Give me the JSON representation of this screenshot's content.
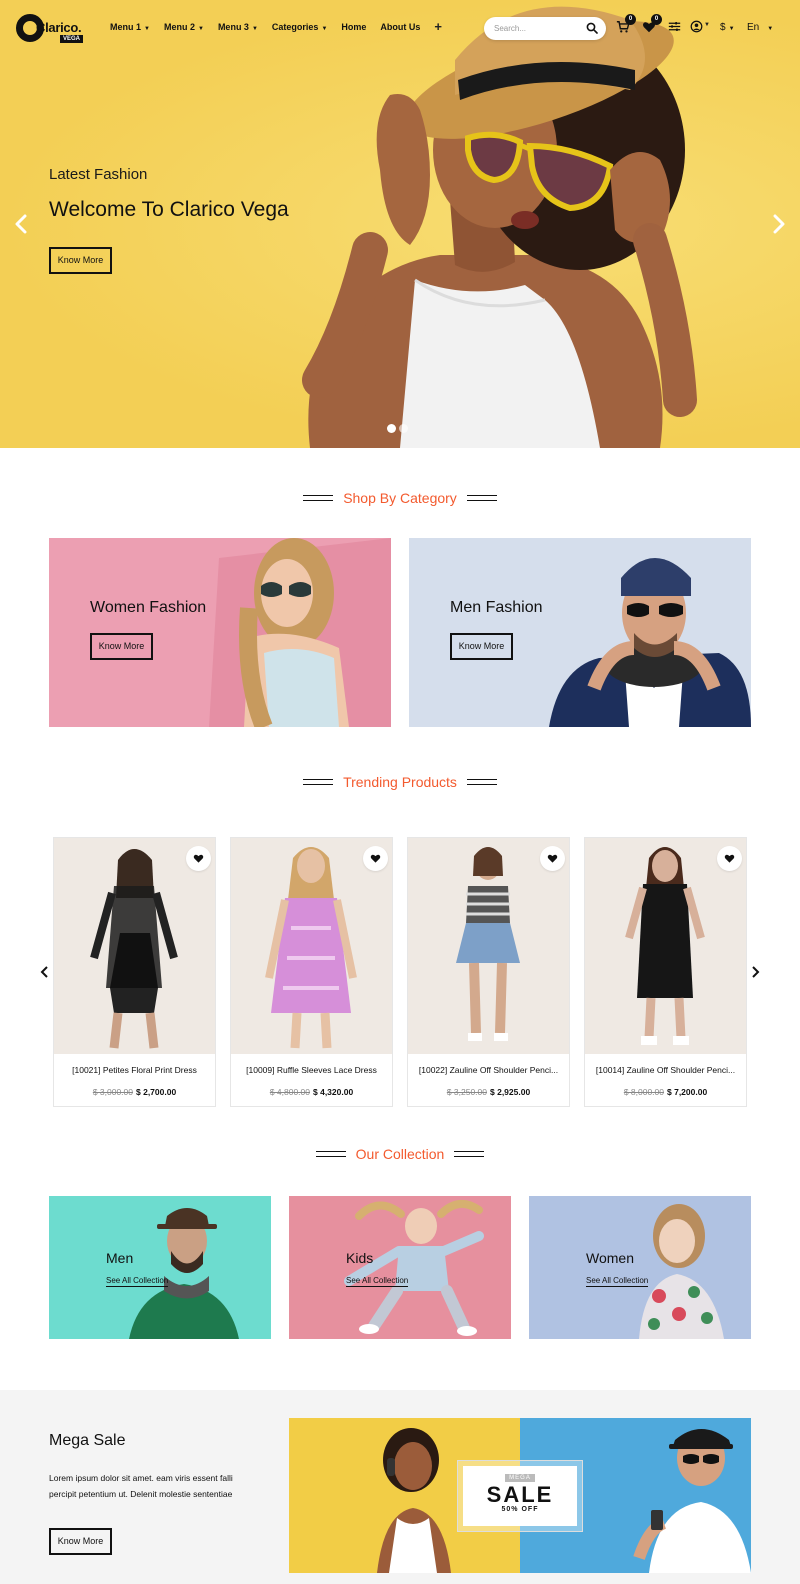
{
  "brand": {
    "name": "Clarico.",
    "tag": "VEGA"
  },
  "nav": {
    "items": [
      "Menu 1",
      "Menu 2",
      "Menu 3",
      "Categories",
      "Home",
      "About Us"
    ],
    "dropdown_flags": [
      true,
      true,
      true,
      true,
      false,
      false
    ],
    "plus": "+"
  },
  "search": {
    "placeholder": "Search..."
  },
  "header_icons": {
    "cart_count": "0",
    "wishlist_count": "0",
    "currency": "$",
    "language": "En"
  },
  "hero": {
    "subtitle": "Latest Fashion",
    "title": "Welcome To Clarico Vega",
    "button": "Know More",
    "slide_count": 2,
    "active_slide": 0,
    "bg_color": "#f6d765"
  },
  "shop_by_category": {
    "title": "Shop By Category",
    "cards": [
      {
        "label": "Women Fashion",
        "button": "Know More",
        "bg": "#ec9fb2"
      },
      {
        "label": "Men Fashion",
        "button": "Know More",
        "bg": "#cfd9ea"
      }
    ]
  },
  "trending": {
    "title": "Trending Products",
    "products": [
      {
        "name": "[10021] Petites Floral Print Dress",
        "old_price": "$ 3,000.00",
        "price": "$ 2,700.00"
      },
      {
        "name": "[10009] Ruffle Sleeves Lace Dress",
        "old_price": "$ 4,800.00",
        "price": "$ 4,320.00"
      },
      {
        "name": "[10022] Zauline Off Shoulder Penci...",
        "old_price": "$ 3,250.00",
        "price": "$ 2,925.00"
      },
      {
        "name": "[10014] Zauline Off Shoulder Penci...",
        "old_price": "$ 8,000.00",
        "price": "$ 7,200.00"
      }
    ]
  },
  "collection": {
    "title": "Our Collection",
    "cards": [
      {
        "label": "Men",
        "link": "See All Collection",
        "bg": "#6ddccf"
      },
      {
        "label": "Kids",
        "link": "See All Collection",
        "bg": "#e6909e"
      },
      {
        "label": "Women",
        "link": "See All Collection",
        "bg": "#b0c2e2"
      }
    ]
  },
  "mega_sale": {
    "title": "Mega Sale",
    "text": "Lorem ipsum dolor sit amet. eam viris essent falli percipit petentium ut. Delenit molestie sententiae",
    "button": "Know More",
    "banner": {
      "tag": "MEGA",
      "word": "SALE",
      "off": "50% OFF",
      "left_bg": "#f2cd46",
      "right_bg": "#4fa9dc"
    }
  },
  "colors": {
    "accent": "#f35a2e",
    "ink": "#111111"
  }
}
